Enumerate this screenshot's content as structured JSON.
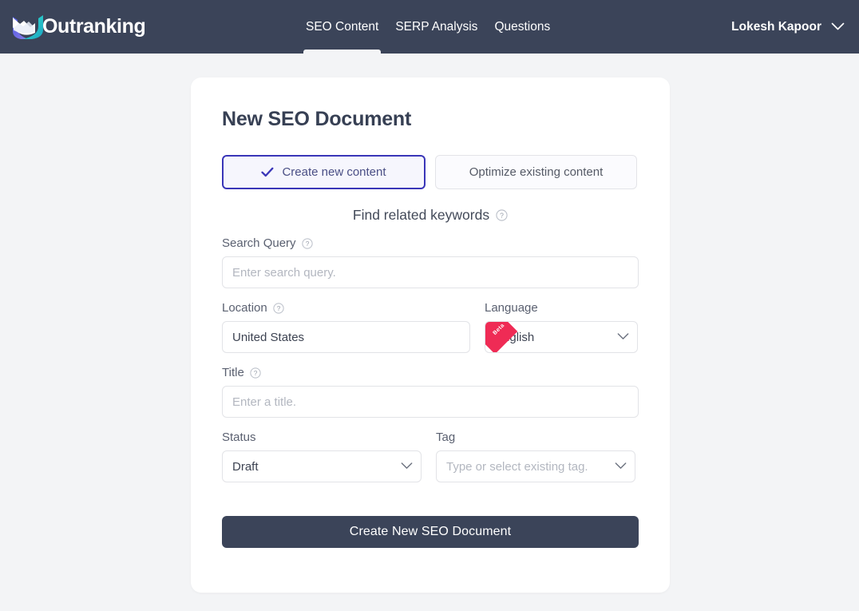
{
  "header": {
    "brand": "Outranking",
    "logo_icon": "outranking-logo-icon",
    "nav": [
      {
        "label": "SEO Content",
        "active": true
      },
      {
        "label": "SERP Analysis",
        "active": false
      },
      {
        "label": "Questions",
        "active": false
      }
    ],
    "user": {
      "name": "Lokesh Kapoor",
      "chevron_icon": "chevron-down-icon"
    }
  },
  "card": {
    "title": "New SEO Document",
    "modes": {
      "create": {
        "label": "Create new content",
        "selected": true,
        "icon": "check-icon"
      },
      "optimize": {
        "label": "Optimize existing content",
        "selected": false
      }
    },
    "section_heading": "Find related keywords",
    "form": {
      "search_query": {
        "label": "Search Query",
        "value": "",
        "placeholder": "Enter search query.",
        "help_icon": "question-circle-icon"
      },
      "location": {
        "label": "Location",
        "value": "United States",
        "placeholder": "",
        "help_icon": "question-circle-icon"
      },
      "language": {
        "label": "Language",
        "value": "English",
        "badge": "Beta",
        "chevron_icon": "chevron-down-icon"
      },
      "title": {
        "label": "Title",
        "value": "",
        "placeholder": "Enter a title.",
        "help_icon": "question-circle-icon"
      },
      "status": {
        "label": "Status",
        "value": "Draft",
        "chevron_icon": "chevron-down-icon"
      },
      "tag": {
        "label": "Tag",
        "value": "",
        "placeholder": "Type or select existing tag.",
        "chevron_icon": "chevron-down-icon"
      }
    },
    "submit_label": "Create New SEO Document"
  },
  "colors": {
    "header_bg": "#3b4459",
    "page_bg": "#f3f4f6",
    "card_bg": "#ffffff",
    "accent_indigo": "#3a36b8",
    "badge_red": "#ef2b55",
    "title_text": "#374054"
  }
}
